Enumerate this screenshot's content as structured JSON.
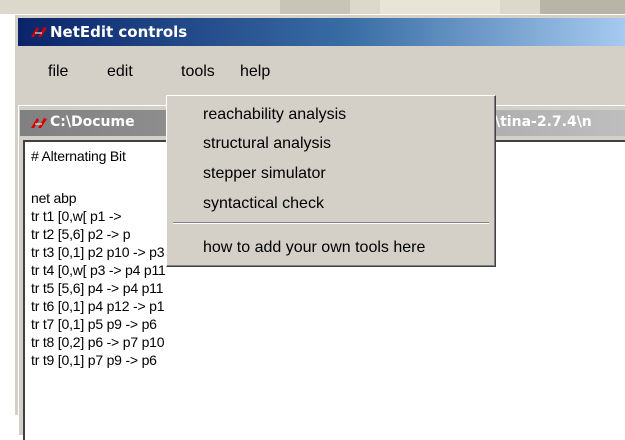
{
  "window": {
    "title": "NetEdit controls"
  },
  "menubar": {
    "items": [
      "file",
      "edit",
      "tools",
      "help"
    ]
  },
  "tools_menu": {
    "items": [
      "reachability analysis",
      "structural analysis",
      "stepper simulator",
      "syntactical check"
    ],
    "extra": "how to add your own tools here"
  },
  "inner_window": {
    "title_left": "C:\\Docume",
    "title_right": "\\tina-2.7.4\\n"
  },
  "editor": {
    "lines": [
      "# Alternating Bit",
      "",
      "net abp",
      "tr t1 [0,w[ p1  ->",
      "tr t2 [5,6] p2  -> p",
      "tr t3 [0,1] p2 p10 -> p3",
      "tr t4 [0,w[ p3  -> p4 p11",
      "tr t5 [5,6] p4  -> p4 p11",
      "tr t6 [0,1] p4 p12 -> p1",
      "tr t7 [0,1] p5 p9 -> p6",
      "tr t8 [0,2] p6  -> p7 p10",
      "tr t9 [0,1] p7 p9 -> p6"
    ]
  },
  "colors": {
    "titlebar_start": "#0a246a",
    "titlebar_end": "#a6caf0",
    "face": "#d4d0c8",
    "tk_logo": "#d40000"
  },
  "icons": {
    "app_logo": "tk-feather-icon"
  }
}
